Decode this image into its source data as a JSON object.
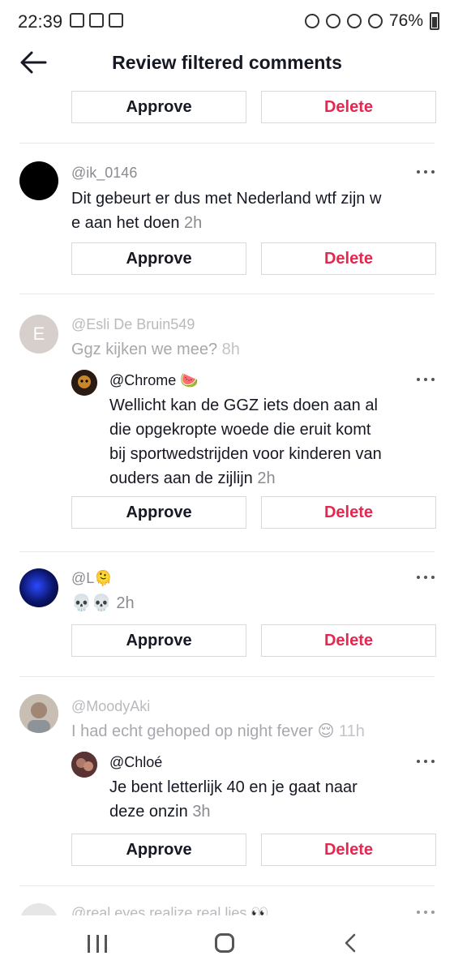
{
  "status": {
    "time": "22:39",
    "battery": "76%"
  },
  "header": {
    "title": "Review filtered comments"
  },
  "buttons": {
    "approve": "Approve",
    "delete": "Delete"
  },
  "comments": [
    {
      "username": "@ik_0146",
      "line1": "Dit gebeurt er dus met Nederland wtf zijn w",
      "line2": "e aan het doen",
      "time": "2h"
    },
    {
      "username": "@Esli De Bruin549",
      "text": "Ggz kijken we mee?",
      "time": "8h",
      "reply": {
        "username": "@Chrome 🍉",
        "lines": [
          "Wellicht kan de GGZ iets doen aan al",
          "die opgekropte woede die eruit komt",
          "bij sportwedstrijden voor kinderen van",
          "ouders aan de zijlijn"
        ],
        "time": "2h"
      }
    },
    {
      "username": "@L🫠",
      "text": "💀💀",
      "time": "2h"
    },
    {
      "username": "@MoodyAki",
      "text": "I had echt gehoped op night fever 😌",
      "time": "11h",
      "reply": {
        "username": "@Chloé",
        "lines": [
          "Je bent letterlijk 40 en je gaat naar",
          "deze onzin"
        ],
        "time": "3h"
      }
    },
    {
      "username": "@real eyes realize real lies 👀"
    }
  ],
  "colors": {
    "delete": "#e5284f",
    "text": "#161823",
    "muted": "#8a8b91"
  }
}
